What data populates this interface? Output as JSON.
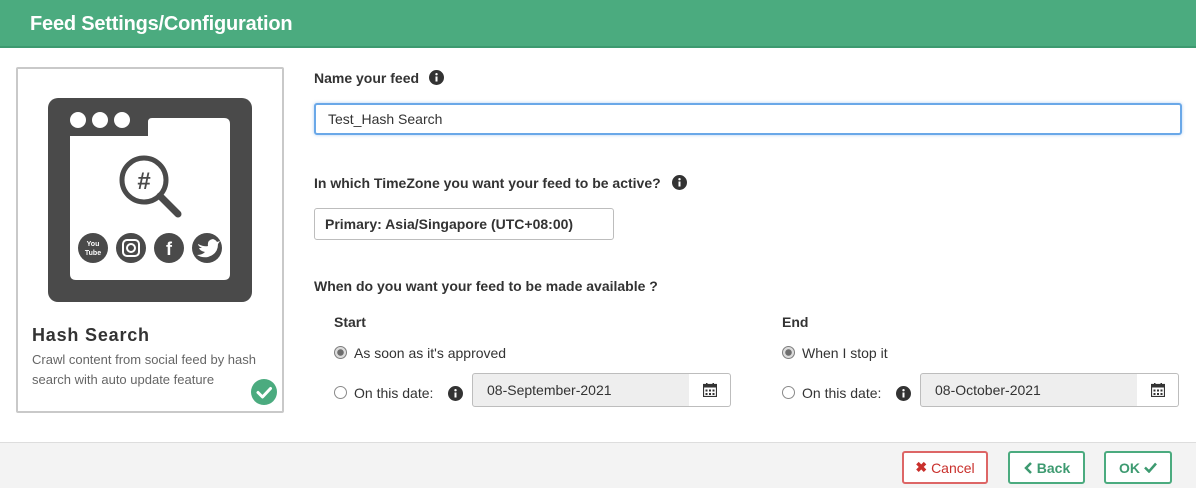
{
  "header": {
    "title": "Feed Settings/Configuration"
  },
  "card": {
    "title": "Hash Search",
    "description": "Crawl content from social feed by hash search with auto update feature",
    "icon": "hash-search-icon",
    "selected": true
  },
  "form": {
    "name_label": "Name your feed",
    "name_value": "Test_Hash Search",
    "timezone_label": "In which TimeZone you want your feed to be active?",
    "timezone_value": "Primary: Asia/Singapore (UTC+08:00)",
    "availability_label": "When do you want your feed to be made available ?",
    "start": {
      "label": "Start",
      "option_approved": "As soon as it's approved",
      "option_date": "On this date:",
      "date_value": "08-September-2021",
      "selected": "approved"
    },
    "end": {
      "label": "End",
      "option_stop": "When I stop it",
      "option_date": "On this date:",
      "date_value": "08-October-2021",
      "selected": "stop"
    }
  },
  "footer": {
    "cancel_label": "Cancel",
    "back_label": "Back",
    "ok_label": "OK"
  },
  "colors": {
    "accent": "#4bab7f",
    "danger": "#c9302c",
    "focus": "#6aa8e8"
  }
}
